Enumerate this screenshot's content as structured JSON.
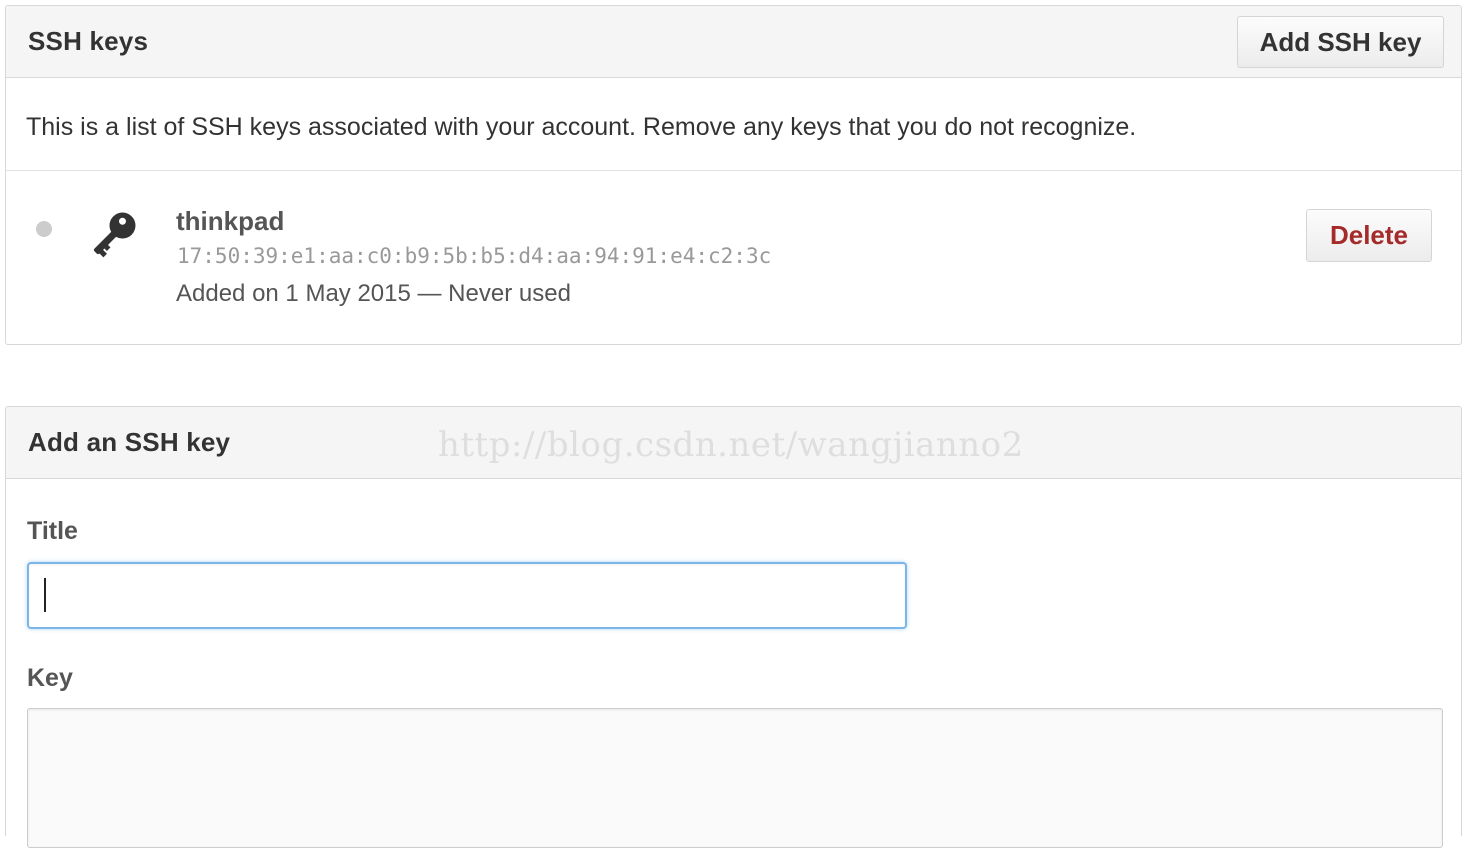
{
  "ssh_keys_panel": {
    "title": "SSH keys",
    "add_button_label": "Add SSH key",
    "intro_text": "This is a list of SSH keys associated with your account. Remove any keys that you do not recognize.",
    "keys": [
      {
        "name": "thinkpad",
        "fingerprint": "17:50:39:e1:aa:c0:b9:5b:b5:d4:aa:94:91:e4:c2:3c",
        "meta": "Added on 1 May 2015 — Never used",
        "status": "inactive",
        "icon": "key-icon",
        "delete_label": "Delete"
      }
    ]
  },
  "add_key_panel": {
    "title": "Add an SSH key",
    "watermark": "http://blog.csdn.net/wangjianno2",
    "title_field": {
      "label": "Title",
      "value": "",
      "placeholder": ""
    },
    "key_field": {
      "label": "Key",
      "value": "",
      "placeholder": ""
    }
  },
  "colors": {
    "header_bg": "#f5f5f5",
    "border": "#d8d8d8",
    "delete_text": "#a52a2a",
    "focus_border": "#7cb6e8",
    "status_dot": "#cccccc"
  }
}
